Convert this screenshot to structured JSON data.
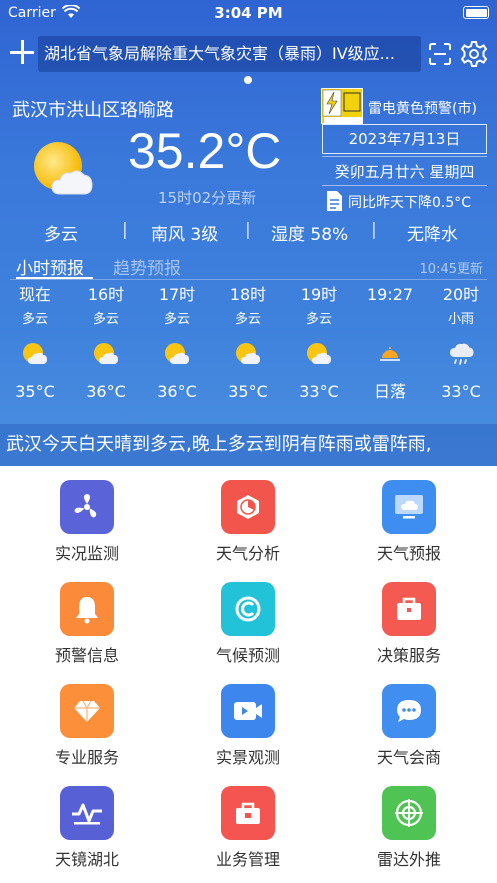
{
  "status": {
    "carrier": "Carrier",
    "time": "3:04 PM"
  },
  "ticker": "湖北省气象局解除重大气象灾害（暴雨）IV级应...",
  "location": "武汉市洪山区珞喻路",
  "current": {
    "temperature": "35.2°C",
    "updated": "15时02分更新",
    "warning": "雷电黄色预警(市)",
    "date": "2023年7月13日",
    "lunar": "癸卯五月廿六 星期四",
    "compare": "同比昨天下降0.5°C"
  },
  "summary": {
    "condition": "多云",
    "wind": "南风 3级",
    "humidity": "湿度 58%",
    "rain": "无降水",
    "separator": "|"
  },
  "tabs": {
    "hourly": "小时预报",
    "trend": "趋势预报",
    "updated": "10:45更新"
  },
  "hourly": [
    {
      "time": "现在",
      "cond": "多云",
      "icon": "sun-cloud-icon",
      "temp": "35°C"
    },
    {
      "time": "16时",
      "cond": "多云",
      "icon": "sun-cloud-icon",
      "temp": "36°C"
    },
    {
      "time": "17时",
      "cond": "多云",
      "icon": "sun-cloud-icon",
      "temp": "36°C"
    },
    {
      "time": "18时",
      "cond": "多云",
      "icon": "sun-cloud-icon",
      "temp": "35°C"
    },
    {
      "time": "19时",
      "cond": "多云",
      "icon": "sun-cloud-icon",
      "temp": "33°C"
    },
    {
      "time": "19:27",
      "cond": "",
      "icon": "sunset-icon",
      "temp": "日落"
    },
    {
      "time": "20时",
      "cond": "小雨",
      "icon": "light-rain-icon",
      "temp": "33°C"
    }
  ],
  "forecast_text": "武汉今天白天晴到多云,晚上多云到阴有阵雨或雷阵雨,",
  "menu": [
    {
      "label": "实况监测",
      "icon": "fan-icon",
      "color": "#5b63d9"
    },
    {
      "label": "天气分析",
      "icon": "pie-chart-icon",
      "color": "#f2554b"
    },
    {
      "label": "天气预报",
      "icon": "monitor-cloud-icon",
      "color": "#3d8ef0"
    },
    {
      "label": "预警信息",
      "icon": "bell-icon",
      "color": "#fb8a3a"
    },
    {
      "label": "气候预测",
      "icon": "climate-icon",
      "color": "#22c3d8"
    },
    {
      "label": "决策服务",
      "icon": "briefcase-icon",
      "color": "#f55a52"
    },
    {
      "label": "专业服务",
      "icon": "diamond-icon",
      "color": "#fb8f3a"
    },
    {
      "label": "实景观测",
      "icon": "video-icon",
      "color": "#3c86ee"
    },
    {
      "label": "天气会商",
      "icon": "chat-icon",
      "color": "#3f8ef0"
    },
    {
      "label": "天镜湖北",
      "icon": "waveform-icon",
      "color": "#5860d6"
    },
    {
      "label": "业务管理",
      "icon": "toolbox-icon",
      "color": "#f45550"
    },
    {
      "label": "雷达外推",
      "icon": "radar-icon",
      "color": "#4fc455"
    }
  ]
}
